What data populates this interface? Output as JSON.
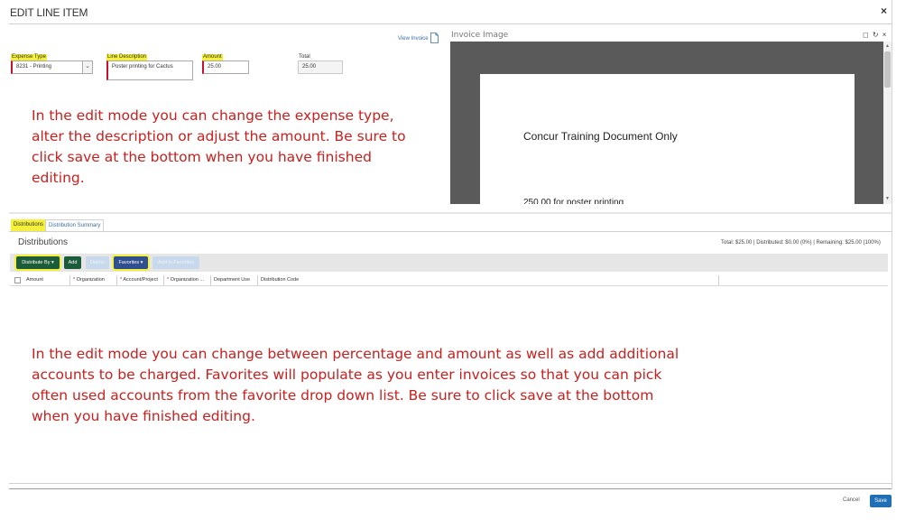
{
  "dialog": {
    "title": "EDIT LINE ITEM",
    "close": "×"
  },
  "fields": {
    "expense_type": {
      "label": "Expense Type",
      "value": "8231 - Printing"
    },
    "line_description": {
      "label": "Line Description",
      "value": "Poster printing for Cactus"
    },
    "amount": {
      "label": "Amount",
      "value": "25.00"
    },
    "total": {
      "label": "Total",
      "value": "25.00"
    }
  },
  "view_invoice": "View Invoice",
  "invoice_panel": {
    "title": "Invoice Image",
    "controls": "◻︎ ↻ ×",
    "document_text": "Concur Training Document Only",
    "cut_text": "250.00 for poster printing"
  },
  "annotations": {
    "top": "In the edit mode you can change the expense type, alter the description or adjust the amount.  Be sure to click save at the bottom when you have finished editing.",
    "bottom": "In the edit mode you can change between percentage  and amount as well as add additional accounts to be charged.  Favorites will populate as you enter invoices so that you can pick often used accounts from the favorite drop down list.  Be sure to click save at the bottom when you have finished editing."
  },
  "tabs": [
    "Distributions",
    "Distribution Summary"
  ],
  "distributions": {
    "title": "Distributions",
    "summary": "Total: $25.00  |  Distributed: $0.00 (0%)  |  Remaining: $25.00 (100%)"
  },
  "toolbar": {
    "distribute_by": "Distribute By ▾",
    "add": "Add",
    "delete": "Delete",
    "favorites": "Favorites ▾",
    "add_to_favorites": "Add to Favorites"
  },
  "columns": [
    "Amount",
    "Organization",
    "Account/Project",
    "Organization ...",
    "Department Use",
    "Distribution Code"
  ],
  "columns_required": [
    "",
    "*",
    "*",
    "*",
    "",
    ""
  ],
  "footer": {
    "cancel": "Cancel",
    "save": "Save"
  },
  "colors": {
    "highlight": "#f5f13a",
    "annotation": "#c8201e",
    "save": "#1f6fb5",
    "toolbar_green": "#1c5c3a",
    "toolbar_blue": "#2f4f8f"
  }
}
